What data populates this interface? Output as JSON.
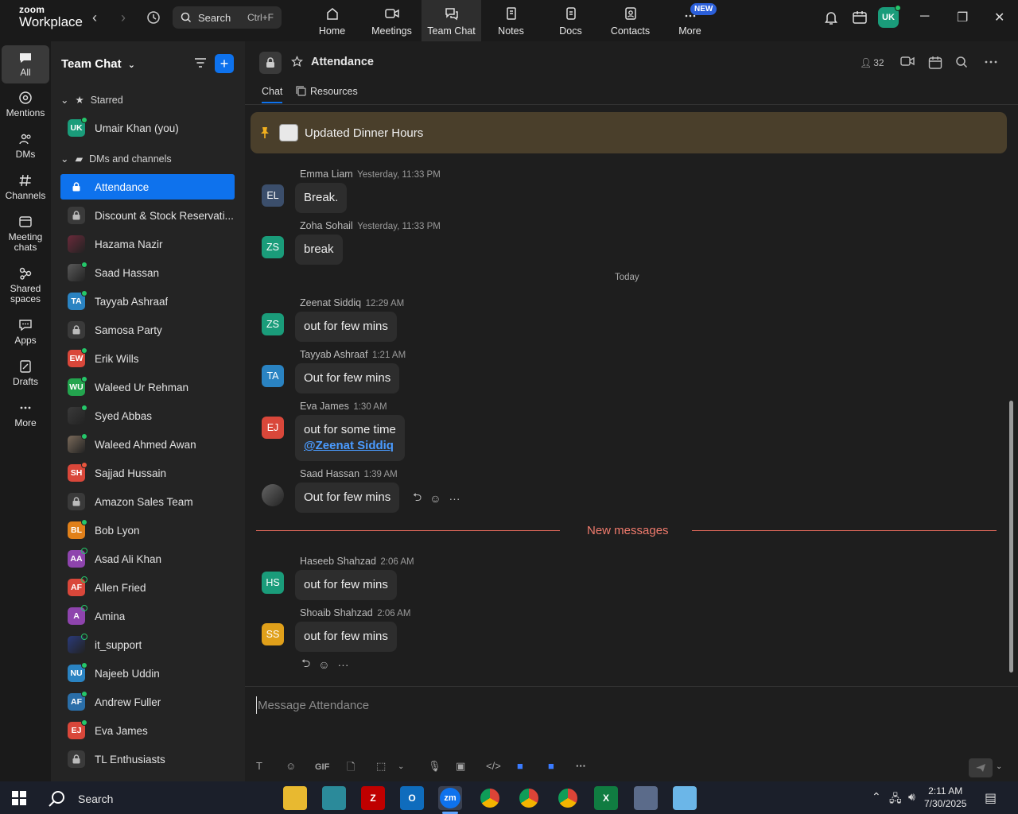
{
  "topbar": {
    "logo_line1": "zoom",
    "logo_line2": "Workplace",
    "search_label": "Search",
    "search_shortcut": "Ctrl+F",
    "tabs": [
      {
        "label": "Home",
        "icon": "home-icon"
      },
      {
        "label": "Meetings",
        "icon": "video-icon"
      },
      {
        "label": "Team Chat",
        "icon": "chat-icon"
      },
      {
        "label": "Notes",
        "icon": "notes-icon"
      },
      {
        "label": "Docs",
        "icon": "docs-icon"
      },
      {
        "label": "Contacts",
        "icon": "contacts-icon"
      },
      {
        "label": "More",
        "icon": "more-icon"
      }
    ],
    "new_badge": "NEW",
    "user_initials": "UK"
  },
  "rail": [
    {
      "label": "All",
      "icon": "chat-bubble-icon"
    },
    {
      "label": "Mentions",
      "icon": "at-icon"
    },
    {
      "label": "DMs",
      "icon": "people-icon"
    },
    {
      "label": "Channels",
      "icon": "hash-icon"
    },
    {
      "label": "Meeting chats",
      "icon": "meeting-chat-icon"
    },
    {
      "label": "Shared spaces",
      "icon": "shared-icon"
    },
    {
      "label": "Apps",
      "icon": "apps-icon"
    },
    {
      "label": "Drafts",
      "icon": "drafts-icon"
    },
    {
      "label": "More",
      "icon": "ellipsis-icon"
    }
  ],
  "sidebar": {
    "title": "Team Chat",
    "starred_label": "Starred",
    "starred": [
      {
        "label": "Umair Khan (you)",
        "initials": "UK",
        "color": "#1a9c7a",
        "status": "online"
      }
    ],
    "dms_label": "DMs and channels",
    "items": [
      {
        "label": "Attendance",
        "kind": "lock",
        "active": true
      },
      {
        "label": "Discount & Stock Reservati...",
        "kind": "lock"
      },
      {
        "label": "Hazama Nazir",
        "kind": "photo",
        "color": "#6a2a3a"
      },
      {
        "label": "Saad Hassan",
        "kind": "photo",
        "color": "#5a5a5a",
        "status": "online"
      },
      {
        "label": "Tayyab Ashraaf",
        "initials": "TA",
        "color": "#2a83c2",
        "status": "online"
      },
      {
        "label": "Samosa Party",
        "kind": "lock"
      },
      {
        "label": "Erik Wills",
        "initials": "EW",
        "color": "#d9473a",
        "status": "online"
      },
      {
        "label": "Waleed Ur Rehman",
        "initials": "WU",
        "color": "#23a44e",
        "status": "online"
      },
      {
        "label": "Syed Abbas",
        "kind": "photo",
        "color": "#3a3a3a",
        "status": "online"
      },
      {
        "label": "Waleed Ahmed Awan",
        "kind": "photo",
        "color": "#7a6a5a",
        "status": "online"
      },
      {
        "label": "Sajjad Hussain",
        "initials": "SH",
        "color": "#d9473a",
        "status": "red"
      },
      {
        "label": "Amazon Sales Team",
        "kind": "lock"
      },
      {
        "label": "Bob Lyon",
        "initials": "BL",
        "color": "#e0801a",
        "status": "online"
      },
      {
        "label": "Asad Ali Khan",
        "initials": "AA",
        "color": "#8e44ad",
        "status": "offline"
      },
      {
        "label": "Allen Fried",
        "initials": "AF",
        "color": "#d9473a",
        "status": "offline"
      },
      {
        "label": "Amina",
        "initials": "A",
        "color": "#8e44ad",
        "status": "offline"
      },
      {
        "label": "it_support",
        "kind": "photo",
        "color": "#2a3a7a",
        "status": "offline"
      },
      {
        "label": "Najeeb Uddin",
        "initials": "NU",
        "color": "#2a83c2",
        "status": "online"
      },
      {
        "label": "Andrew Fuller",
        "initials": "AF",
        "color": "#2a6ea8",
        "status": "online"
      },
      {
        "label": "Eva James",
        "initials": "EJ",
        "color": "#d9473a",
        "status": "online"
      },
      {
        "label": "TL Enthusiasts",
        "kind": "lock"
      }
    ]
  },
  "channel": {
    "name": "Attendance",
    "member_count": "32",
    "tab_chat": "Chat",
    "tab_resources": "Resources",
    "pinned": "Updated Dinner Hours",
    "today_label": "Today",
    "new_messages_label": "New messages",
    "composer_placeholder": "Message Attendance"
  },
  "messages": [
    {
      "name": "Emma Liam",
      "time": "Yesterday, 11:33 PM",
      "text": "Break.",
      "initials": "EL",
      "color": "#3b4e6b"
    },
    {
      "name": "Zoha Sohail",
      "time": "Yesterday, 11:33 PM",
      "text": "break",
      "initials": "ZS",
      "color": "#1a9c7a"
    },
    {
      "name": "Zeenat Siddiq",
      "time": "12:29 AM",
      "text": "out for few mins",
      "initials": "ZS",
      "color": "#1a9c7a"
    },
    {
      "name": "Tayyab Ashraaf",
      "time": "1:21 AM",
      "text": "Out for few mins",
      "initials": "TA",
      "color": "#2a83c2"
    },
    {
      "name": "Eva James",
      "time": "1:30 AM",
      "text": "out for some time",
      "mention": "@Zeenat Siddiq",
      "initials": "EJ",
      "color": "#d9473a"
    },
    {
      "name": "Saad Hassan",
      "time": "1:39 AM",
      "text": "Out for few mins",
      "initials": "",
      "color": "#4a4a4a"
    },
    {
      "name": "Haseeb Shahzad",
      "time": "2:06 AM",
      "text": "out for few mins",
      "initials": "HS",
      "color": "#1a9c7a"
    },
    {
      "name": "Shoaib Shahzad",
      "time": "2:06 AM",
      "text": "out for few mins",
      "initials": "SS",
      "color": "#e0a01a"
    }
  ],
  "composer_tools": {
    "gif": "GIF"
  },
  "taskbar": {
    "search_label": "Search",
    "apps": [
      "File Explorer",
      "App",
      "FileZilla",
      "Outlook",
      "Zoom",
      "Chrome",
      "Chrome",
      "Chrome",
      "Excel",
      "Calculator",
      "App"
    ],
    "zoom_label": "zm",
    "time": "2:11 AM",
    "date": "7/30/2025"
  },
  "colors": {
    "accent": "#0e72ed",
    "new_messages": "#e0685a",
    "online": "#24c76a"
  }
}
